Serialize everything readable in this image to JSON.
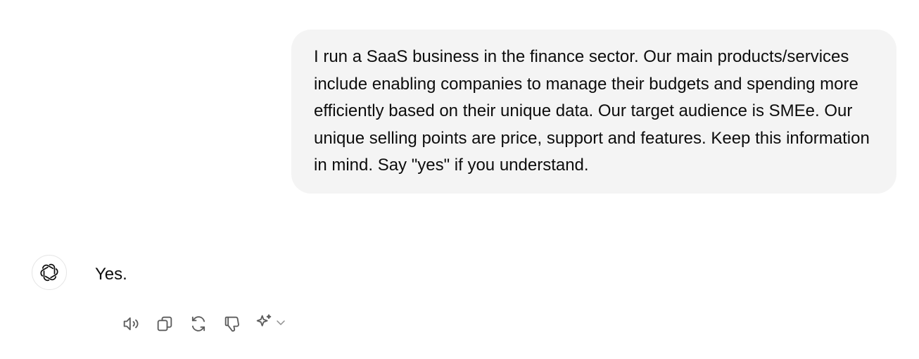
{
  "user_message": {
    "text": "I run a SaaS business in the finance sector. Our main products/services include enabling companies to manage their budgets and spending more efficiently based on their unique data. Our target audience is SMEe. Our unique selling points are price, support and features. Keep this information in mind. Say \"yes\" if you understand."
  },
  "assistant_message": {
    "avatar_icon": "openai-logo-icon",
    "text": "Yes."
  },
  "actions": {
    "read_aloud_icon": "speaker-icon",
    "copy_icon": "copy-icon",
    "regenerate_icon": "refresh-icon",
    "dislike_icon": "thumbs-down-icon",
    "model_icon": "sparkle-icon",
    "model_dropdown_icon": "chevron-down-icon"
  },
  "colors": {
    "bubble_bg": "#f4f4f4",
    "icon": "#5d5d5d",
    "text": "#0d0d0d"
  }
}
